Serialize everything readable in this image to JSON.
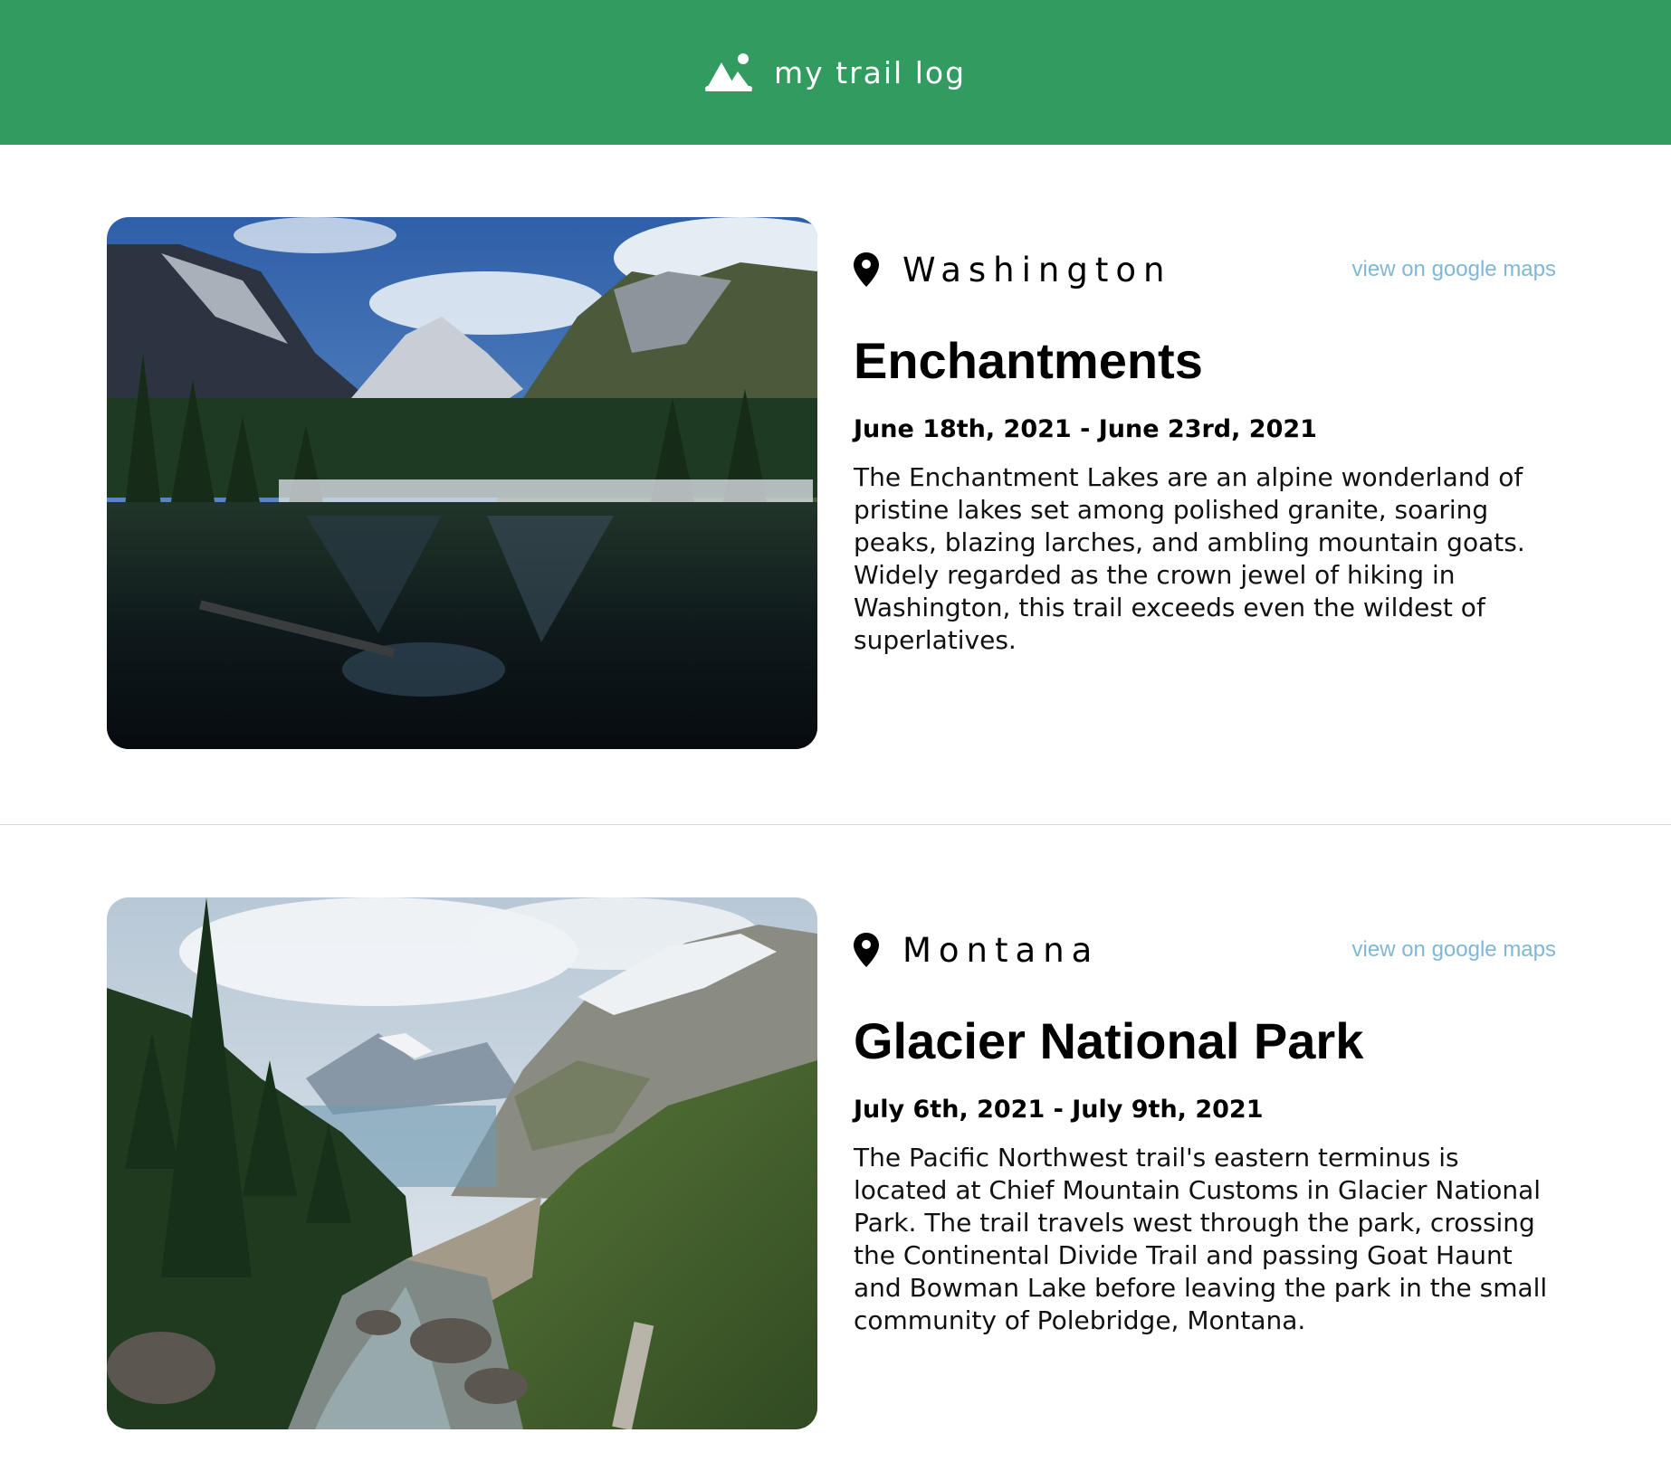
{
  "header": {
    "brand_icon": "mountain-icon",
    "title": "my trail log",
    "background_color": "#319b60"
  },
  "entries": [
    {
      "location": "Washington",
      "location_icon": "map-pin-icon",
      "maps_link": "view on google maps",
      "title": "Enchantments",
      "dates": "June 18th, 2021 - June 23rd, 2021",
      "description": "The Enchantment Lakes are an alpine wonderland of pristine lakes set among polished granite, soaring peaks, blazing larches, and ambling mountain goats. Widely regarded as the crown jewel of hiking in Washington, this trail exceeds even the wildest of superlatives."
    },
    {
      "location": "Montana",
      "location_icon": "map-pin-icon",
      "maps_link": "view on google maps",
      "title": "Glacier National Park",
      "dates": "July 6th, 2021 - July 9th, 2021",
      "description": "The Pacific Northwest trail's eastern terminus is located at Chief Mountain Customs in Glacier National Park. The trail travels west through the park, crossing the Continental Divide Trail and passing Goat Haunt and Bowman Lake before leaving the park in the small community of Polebridge, Montana."
    }
  ],
  "colors": {
    "link": "#7fb7d8",
    "divider": "#d6d6d6"
  }
}
